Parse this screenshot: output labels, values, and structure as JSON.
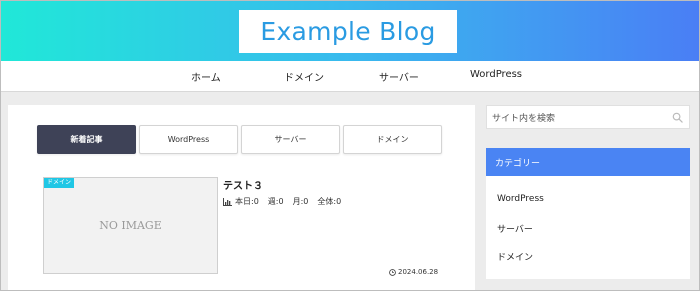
{
  "header": {
    "logo_text": "Example Blog",
    "gradient_colors": [
      "#20e8d8",
      "#39b9ee",
      "#4a7ef5"
    ]
  },
  "nav": {
    "items": [
      {
        "label": "ホーム"
      },
      {
        "label": "ドメイン"
      },
      {
        "label": "サーバー"
      },
      {
        "label": "WordPress"
      }
    ]
  },
  "tabs": {
    "items": [
      {
        "label": "新着記事",
        "active": true
      },
      {
        "label": "WordPress",
        "active": false
      },
      {
        "label": "サーバー",
        "active": false
      },
      {
        "label": "ドメイン",
        "active": false
      }
    ],
    "active_color": "#3e4257"
  },
  "post": {
    "category_badge": "ドメイン",
    "thumbnail_text": "NO IMAGE",
    "title": "テスト３",
    "views": {
      "icon": "bar-chart-icon",
      "today": {
        "label": "本日:",
        "value": "0"
      },
      "week": {
        "label": "週:",
        "value": "0"
      },
      "month": {
        "label": "月:",
        "value": "0"
      },
      "total": {
        "label": "全体:",
        "value": "0"
      }
    },
    "date": "2024.06.28",
    "date_icon": "clock-icon"
  },
  "sidebar": {
    "search_placeholder": "サイト内を検索",
    "search_icon": "search-icon",
    "category_title": "カテゴリー",
    "category_color": "#4a84f3",
    "categories": [
      {
        "label": "WordPress"
      },
      {
        "label": "サーバー"
      },
      {
        "label": "ドメイン"
      }
    ]
  }
}
